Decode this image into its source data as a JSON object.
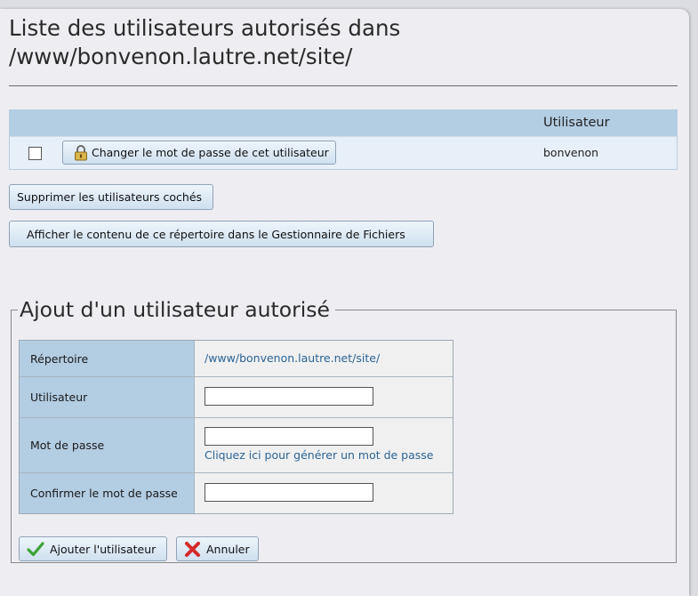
{
  "header": {
    "title": "Liste des utilisateurs autorisés dans /www/bonvenon.lautre.net/site/"
  },
  "users_table": {
    "column_user": "Utilisateur",
    "rows": [
      {
        "change_password_label": "Changer le mot de passe de cet utilisateur",
        "username": "bonvenon"
      }
    ]
  },
  "actions": {
    "delete_label": "Supprimer les utilisateurs cochés",
    "browse_label": "Afficher le contenu de ce répertoire dans le Gestionnaire de Fichiers"
  },
  "add_form": {
    "legend": "Ajout d'un utilisateur autorisé",
    "directory_label": "Répertoire",
    "directory_value": "/www/bonvenon.lautre.net/site/",
    "user_label": "Utilisateur",
    "user_value": "",
    "password_label": "Mot de passe",
    "password_value": "",
    "generate_link": "Cliquez ici pour générer un mot de passe",
    "confirm_label": "Confirmer le mot de passe",
    "confirm_value": "",
    "add_label": "Ajouter l'utilisateur",
    "cancel_label": "Annuler"
  },
  "icons": {
    "lock": "lock-icon",
    "check": "check-icon",
    "cross": "cross-icon"
  },
  "colors": {
    "header_blue": "#b3cde3",
    "link_blue": "#2b6496",
    "add_green": "#3aa334",
    "cancel_red": "#d42a2a"
  }
}
